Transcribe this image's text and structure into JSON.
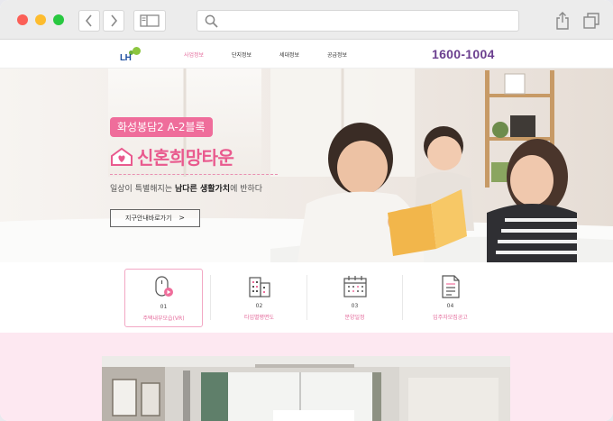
{
  "browser": {
    "icons": [
      "back-icon",
      "forward-icon",
      "sidebar-icon",
      "search-icon",
      "share-icon",
      "tabs-icon"
    ]
  },
  "header": {
    "logo_text": "LH",
    "menu": [
      "사업정보",
      "단지정보",
      "세대정보",
      "공급정보"
    ],
    "phone": "1600-1004"
  },
  "hero": {
    "tag": "화성봉담2 A-2블록",
    "title": "신혼희망타운",
    "subtitle_pre": "일상이 특별해지는 ",
    "subtitle_bold": "남다른 생활가치",
    "subtitle_post": "에 반하다",
    "button": "지구안내바로가기",
    "button_chevron": ">"
  },
  "quick_links": [
    {
      "num": "01",
      "label": "주택내부모습(VR)",
      "icon": "vr-mouse-icon"
    },
    {
      "num": "02",
      "label": "타입별평면도",
      "icon": "building-plan-icon"
    },
    {
      "num": "03",
      "label": "분양일정",
      "icon": "calendar-icon"
    },
    {
      "num": "04",
      "label": "입주자모집공고",
      "icon": "document-icon"
    }
  ],
  "colors": {
    "accent_pink": "#ef6d9b",
    "phone_purple": "#6b3f8f",
    "band_pink": "#fde8f1"
  }
}
